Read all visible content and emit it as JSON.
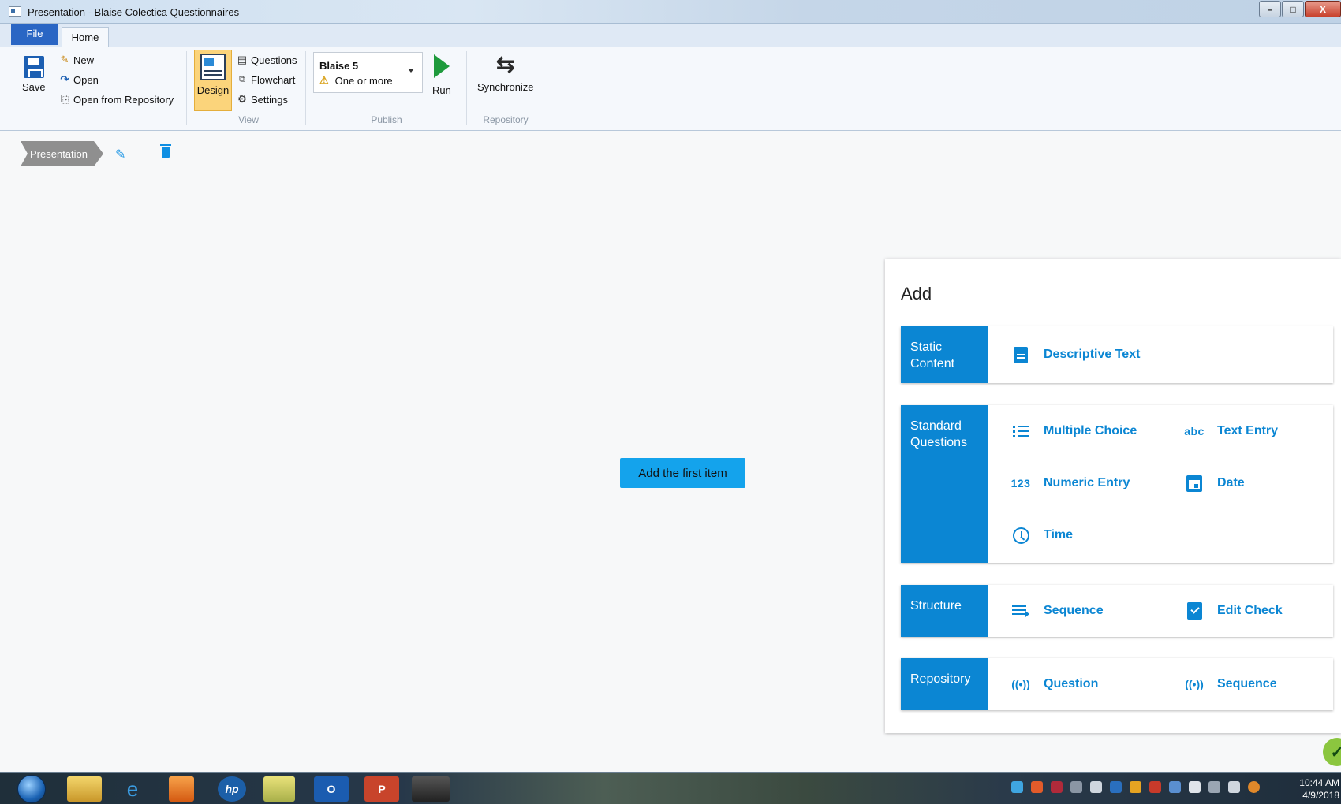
{
  "window": {
    "title": "Presentation - Blaise Colectica Questionnaires",
    "controls": {
      "minimize": "–",
      "maximize": "□",
      "close": "X"
    }
  },
  "ribbon": {
    "tabs": {
      "file": "File",
      "home": "Home"
    },
    "save": "Save",
    "new": "New",
    "open": "Open",
    "open_repo": "Open from Repository",
    "design": "Design",
    "questions": "Questions",
    "flowchart": "Flowchart",
    "settings": "Settings",
    "view_group": "View",
    "publish": {
      "target": "Blaise 5",
      "status": "One or more",
      "group": "Publish"
    },
    "run": "Run",
    "synchronize": "Synchronize",
    "repository_group": "Repository"
  },
  "breadcrumb": {
    "label": "Presentation"
  },
  "main": {
    "add_first": "Add the first item"
  },
  "panel": {
    "title": "Add",
    "sections": {
      "static": {
        "label": "Static Content",
        "items": {
          "descriptive_text": "Descriptive Text"
        }
      },
      "standard": {
        "label": "Standard Questions",
        "items": {
          "multiple_choice": "Multiple Choice",
          "text_entry": "Text Entry",
          "numeric_entry": "Numeric Entry",
          "date": "Date",
          "time": "Time"
        },
        "icons": {
          "text_entry": "abc",
          "numeric_entry": "123"
        }
      },
      "structure": {
        "label": "Structure",
        "items": {
          "sequence": "Sequence",
          "edit_check": "Edit Check"
        }
      },
      "repository": {
        "label": "Repository",
        "items": {
          "question": "Question",
          "sequence": "Sequence"
        },
        "icon_glyph": "((•))"
      }
    }
  },
  "taskbar": {
    "apps": {
      "outlook": "O",
      "powerpoint": "P"
    },
    "time": "10:44 AM",
    "date": "4/9/2018"
  },
  "colors": {
    "accent": "#0b86d3",
    "button": "#14a3ec",
    "design_active": "#fbd47b",
    "run": "#1e9a3c"
  }
}
